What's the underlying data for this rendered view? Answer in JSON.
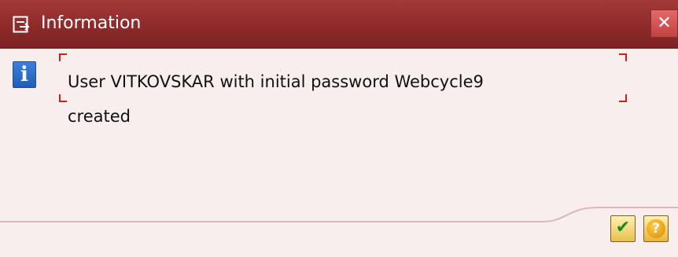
{
  "window": {
    "title": "Information",
    "close_glyph": "✕"
  },
  "message": {
    "line1": "User VITKOVSKAR with initial password Webcycle9",
    "line2": "created",
    "icon": "info-icon",
    "icon_glyph": "i"
  },
  "buttons": {
    "ok": {
      "icon": "checkmark-icon",
      "glyph": "✔"
    },
    "help": {
      "icon": "help-icon",
      "glyph": "?"
    }
  },
  "colors": {
    "titlebar": "#8e2a2a",
    "body": "#f8eeee",
    "focus_frame": "#d41f1f",
    "info_blue": "#1f5fb8"
  }
}
